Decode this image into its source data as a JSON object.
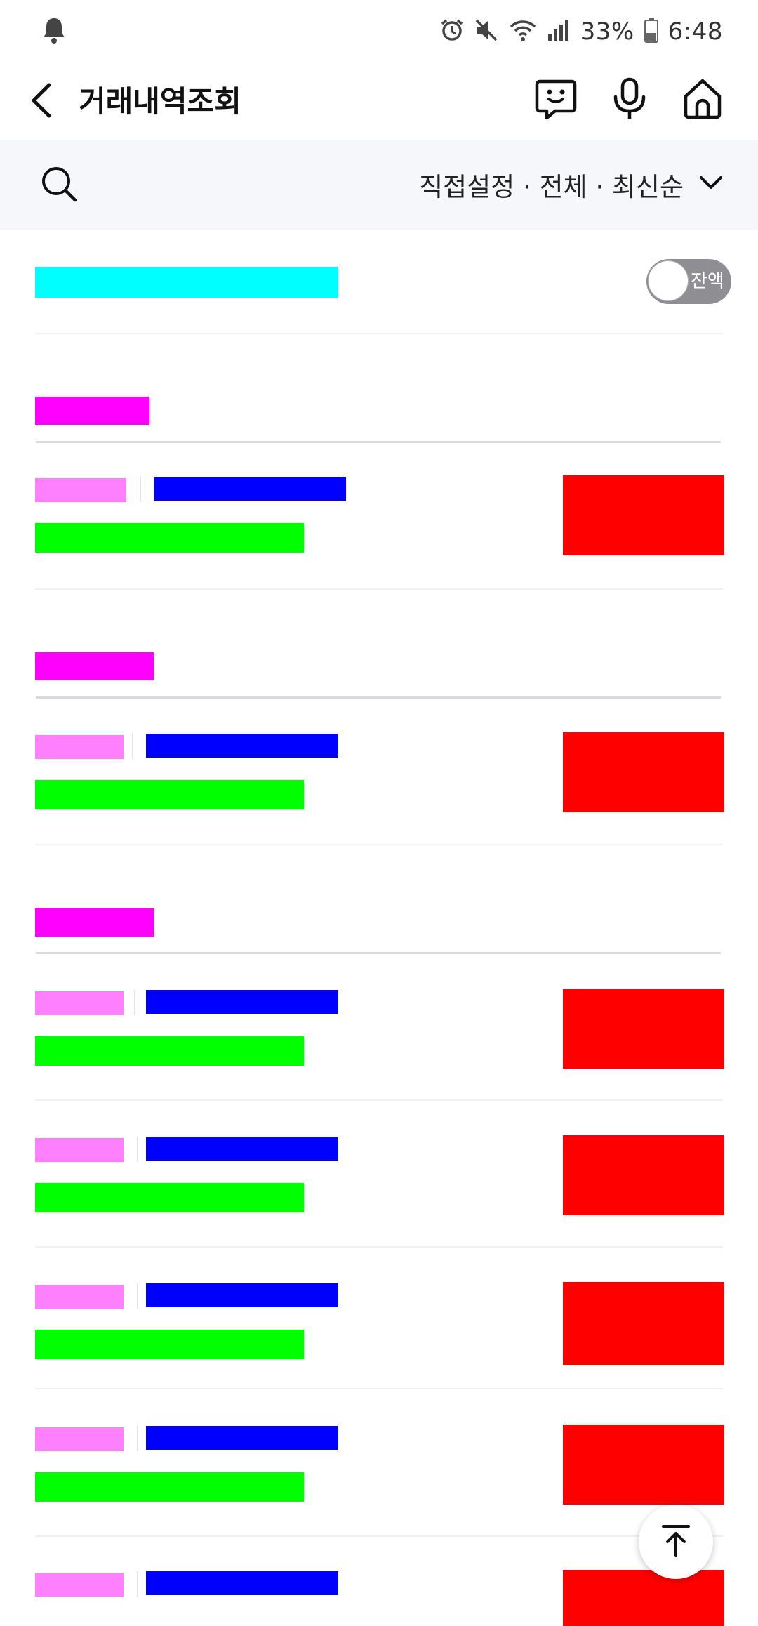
{
  "status_bar": {
    "battery": "33%",
    "time": "6:48",
    "icons": [
      "bell-icon",
      "alarm-icon",
      "mute-icon",
      "wifi-icon",
      "signal-icon",
      "battery-icon"
    ]
  },
  "header": {
    "title": "거래내역조회",
    "icons": [
      "back-arrow-icon",
      "chatbot-icon",
      "microphone-icon",
      "home-icon"
    ]
  },
  "filter": {
    "label": "직접설정 · 전체 · 최신순",
    "icons": [
      "search-icon",
      "chevron-down-icon"
    ]
  },
  "balance_toggle": {
    "label": "잔액",
    "on": false
  },
  "placeholder_colors": {
    "summary": "#00ffff",
    "date": "#ff00ff",
    "time": "#ff80ff",
    "title": "#0000ff",
    "subtitle": "#00ff00",
    "amount": "#ff0000"
  },
  "scroll_top_icon": "arrow-up-to-top-icon"
}
